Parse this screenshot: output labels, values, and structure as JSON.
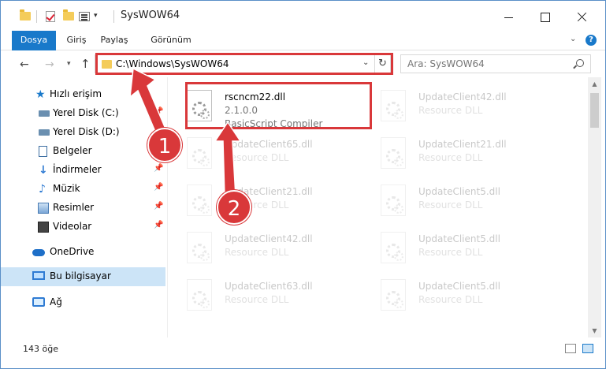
{
  "window": {
    "title": "SysWOW64"
  },
  "ribbon": {
    "tabs": [
      "Dosya",
      "Giriş",
      "Paylaş",
      "Görünüm"
    ]
  },
  "navigation": {
    "address": "C:\\Windows\\SysWOW64",
    "search_placeholder": "Ara: SysWOW64"
  },
  "sidebar": {
    "items": [
      {
        "label": "Hızlı erişim",
        "icon": "star-icon"
      },
      {
        "label": "Yerel Disk (C:)",
        "icon": "disk-icon",
        "pinned": true
      },
      {
        "label": "Yerel Disk (D:)",
        "icon": "disk-icon"
      },
      {
        "label": "Belgeler",
        "icon": "documents-icon"
      },
      {
        "label": "İndirmeler",
        "icon": "download-icon",
        "pinned": true
      },
      {
        "label": "Müzik",
        "icon": "music-icon",
        "pinned": true
      },
      {
        "label": "Resimler",
        "icon": "pictures-icon",
        "pinned": true
      },
      {
        "label": "Videolar",
        "icon": "videos-icon",
        "pinned": true
      },
      {
        "label": "OneDrive",
        "icon": "cloud-icon"
      },
      {
        "label": "Bu bilgisayar",
        "icon": "computer-icon",
        "selected": true
      },
      {
        "label": "Ağ",
        "icon": "network-icon"
      }
    ]
  },
  "files": [
    {
      "name": "rscncm22.dll",
      "version": "2.1.0.0",
      "description": "BasicScript Compiler",
      "highlighted": true
    },
    {
      "name": "UpdateClient42.dll",
      "description": "Resource DLL"
    },
    {
      "name": "UpdateClient65.dll",
      "description": "Resource DLL"
    },
    {
      "name": "UpdateClient21.dll",
      "description": "Resource DLL"
    },
    {
      "name": "UpdateClient21.dll",
      "description": "Resource DLL"
    },
    {
      "name": "UpdateClient5.dll",
      "description": "Resource DLL"
    },
    {
      "name": "UpdateClient42.dll",
      "description": "Resource DLL"
    },
    {
      "name": "UpdateClient5.dll",
      "description": "Resource DLL"
    },
    {
      "name": "UpdateClient63.dll",
      "description": "Resource DLL"
    },
    {
      "name": "UpdateClient5.dll",
      "description": "Resource DLL"
    }
  ],
  "status": {
    "item_count": "143 öğe"
  },
  "annotations": {
    "badge1": "1",
    "badge2": "2",
    "color": "#d9383a"
  }
}
